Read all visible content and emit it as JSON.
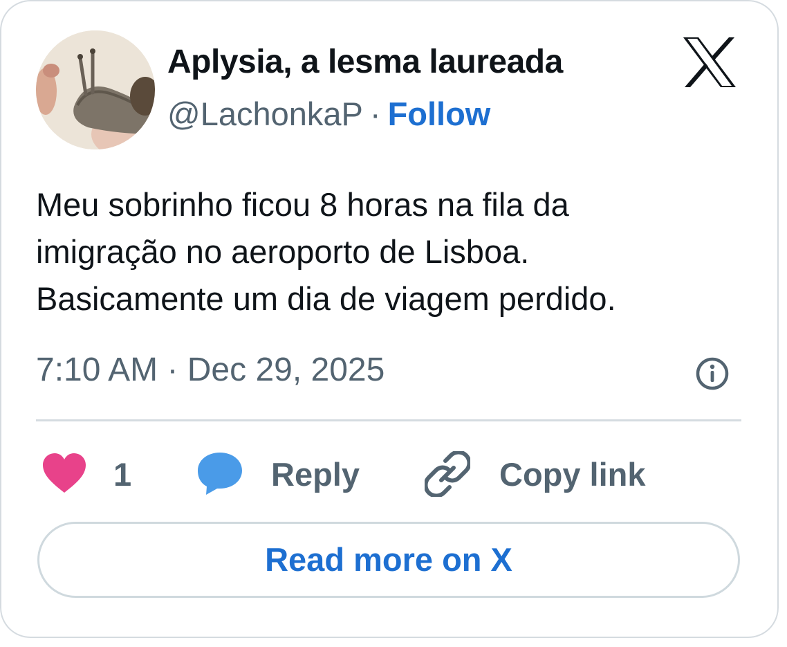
{
  "author": {
    "display_name": "Aplysia, a lesma laureada",
    "handle": "@LachonkaP",
    "separator": "·",
    "follow_label": "Follow",
    "avatar_icon": "snail-avatar",
    "platform_icon": "x-logo-icon"
  },
  "tweet": {
    "text_lines": [
      "Meu sobrinho ficou 8 horas na fila da",
      "imigração no aeroporto de Lisboa.",
      "Basicamente um dia de viagem perdido."
    ],
    "timestamp": "7:10 AM · Dec 29, 2025"
  },
  "actions": {
    "like_count": "1",
    "reply_label": "Reply",
    "copy_link_label": "Copy link"
  },
  "read_more_label": "Read more on X",
  "colors": {
    "accent_blue": "#1d6fd1",
    "heart_pink": "#e8428a",
    "reply_bubble_blue": "#4a9be8",
    "secondary_text": "#536471",
    "border": "#d5dbe0"
  }
}
